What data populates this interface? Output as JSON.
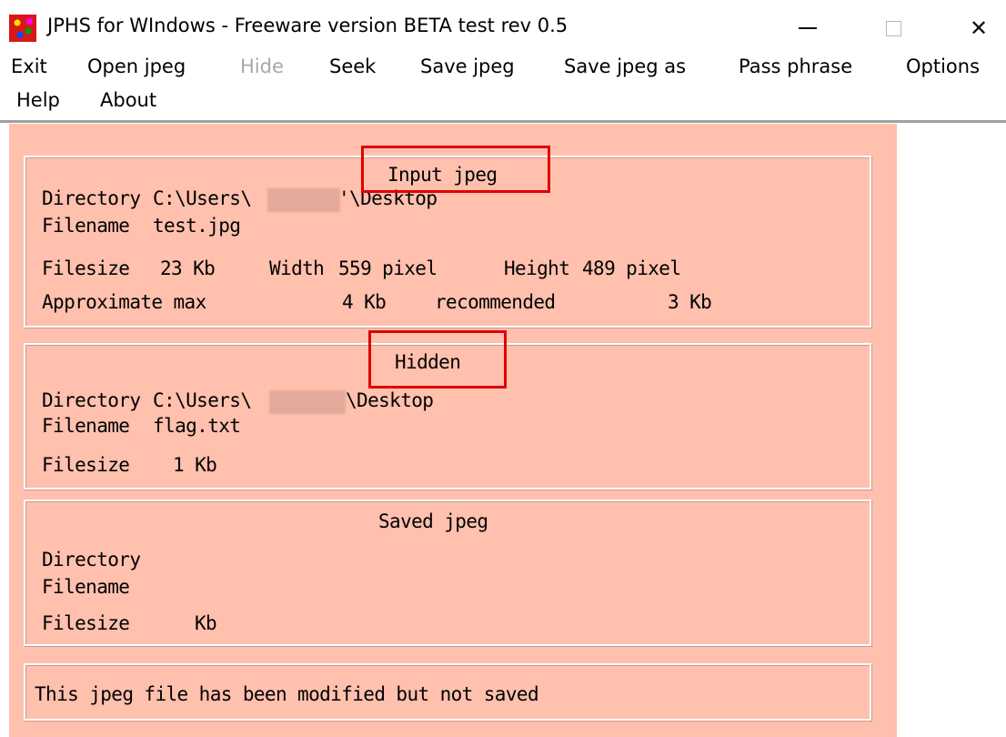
{
  "window": {
    "title": "JPHS for WIndows - Freeware version BETA test rev 0.5",
    "icon": "jphs-app-icon",
    "controls": {
      "minimize": "minimize-icon",
      "maximize": "maximize-icon",
      "close": "close-icon",
      "close_glyph": "✕"
    }
  },
  "menu": {
    "items": [
      {
        "label": "Exit",
        "enabled": true
      },
      {
        "label": "Open jpeg",
        "enabled": true
      },
      {
        "label": "Hide",
        "enabled": false
      },
      {
        "label": "Seek",
        "enabled": true
      },
      {
        "label": "Save jpeg",
        "enabled": true
      },
      {
        "label": "Save jpeg as",
        "enabled": true
      },
      {
        "label": "Pass phrase",
        "enabled": true
      },
      {
        "label": "Options",
        "enabled": true
      },
      {
        "label": "Help",
        "enabled": true
      },
      {
        "label": "About",
        "enabled": true
      }
    ]
  },
  "input_jpeg": {
    "heading": "Input jpeg",
    "directory_label": "Directory",
    "directory_prefix": "C:\\Users\\",
    "directory_suffix": "'\\Desktop",
    "filename_label": "Filename",
    "filename": "test.jpg",
    "filesize_label": "Filesize",
    "filesize": "23 Kb",
    "width_label": "Width",
    "width": "559 pixel",
    "height_label": "Height",
    "height": "489 pixel",
    "approx_label": "Approximate max",
    "approx_max": "4 Kb",
    "recommended_label": "recommended",
    "recommended": "3 Kb"
  },
  "hidden": {
    "heading": "Hidden",
    "directory_label": "Directory",
    "directory_prefix": "C:\\Users\\",
    "directory_suffix": "\\Desktop",
    "filename_label": "Filename",
    "filename": "flag.txt",
    "filesize_label": "Filesize",
    "filesize": "1 Kb"
  },
  "saved_jpeg": {
    "heading": "Saved jpeg",
    "directory_label": "Directory",
    "directory": "",
    "filename_label": "Filename",
    "filename": "",
    "filesize_label": "Filesize",
    "filesize": "Kb"
  },
  "status": {
    "message": "This jpeg file has been modified but not saved"
  },
  "colors": {
    "client_background": "#ffc0ae",
    "annotation_box": "#e00000",
    "disabled_menu": "#a8a8a8"
  }
}
